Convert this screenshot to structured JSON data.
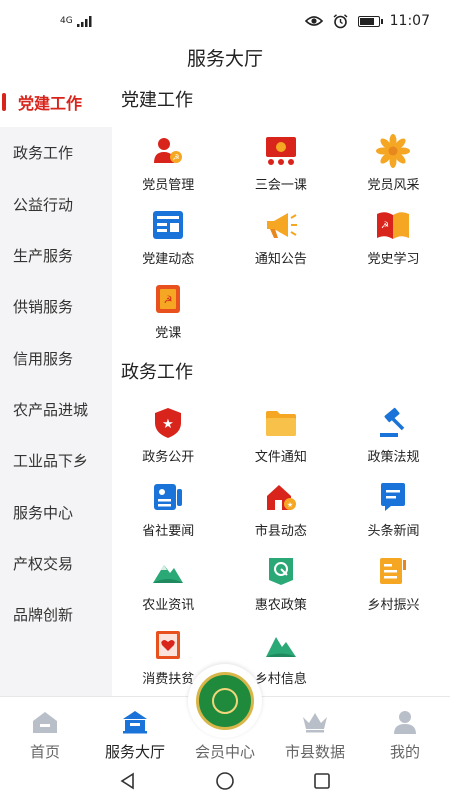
{
  "status_bar": {
    "network": "4G",
    "time": "11:07"
  },
  "page_title": "服务大厅",
  "sidebar": {
    "items": [
      {
        "label": "党建工作",
        "active": true
      },
      {
        "label": "政务工作"
      },
      {
        "label": "公益行动"
      },
      {
        "label": "生产服务"
      },
      {
        "label": "供销服务"
      },
      {
        "label": "信用服务"
      },
      {
        "label": "农产品进城"
      },
      {
        "label": "工业品下乡"
      },
      {
        "label": "服务中心"
      },
      {
        "label": "产权交易"
      },
      {
        "label": "品牌创新"
      }
    ]
  },
  "sections": [
    {
      "title": "党建工作",
      "items": [
        {
          "label": "党员管理",
          "icon": "party-member-icon"
        },
        {
          "label": "三会一课",
          "icon": "meeting-board-icon"
        },
        {
          "label": "党员风采",
          "icon": "flower-icon"
        },
        {
          "label": "党建动态",
          "icon": "news-card-icon"
        },
        {
          "label": "通知公告",
          "icon": "megaphone-icon"
        },
        {
          "label": "党史学习",
          "icon": "open-book-icon"
        },
        {
          "label": "党课",
          "icon": "party-book-icon"
        }
      ]
    },
    {
      "title": "政务工作",
      "items": [
        {
          "label": "政务公开",
          "icon": "shield-star-icon"
        },
        {
          "label": "文件通知",
          "icon": "folder-icon"
        },
        {
          "label": "政策法规",
          "icon": "gavel-icon"
        },
        {
          "label": "省社要闻",
          "icon": "id-card-icon"
        },
        {
          "label": "市县动态",
          "icon": "house-icon"
        },
        {
          "label": "头条新闻",
          "icon": "chat-doc-icon"
        },
        {
          "label": "农业资讯",
          "icon": "mountain-icon"
        },
        {
          "label": "惠农政策",
          "icon": "leaf-badge-icon"
        },
        {
          "label": "乡村振兴",
          "icon": "notebook-icon"
        },
        {
          "label": "消费扶贫",
          "icon": "heart-book-icon"
        },
        {
          "label": "乡村信息",
          "icon": "hills-icon"
        }
      ]
    }
  ],
  "tabbar": {
    "tabs": [
      {
        "label": "首页",
        "icon": "home-icon"
      },
      {
        "label": "服务大厅",
        "icon": "service-hall-icon",
        "active": true
      },
      {
        "label": "会员中心",
        "icon": "member-seal-icon"
      },
      {
        "label": "市县数据",
        "icon": "crown-icon"
      },
      {
        "label": "我的",
        "icon": "user-icon"
      }
    ]
  },
  "colors": {
    "accent": "#d9241b",
    "sidebar_bg": "#f4f4f6",
    "tab_active": "#1a73d8"
  }
}
